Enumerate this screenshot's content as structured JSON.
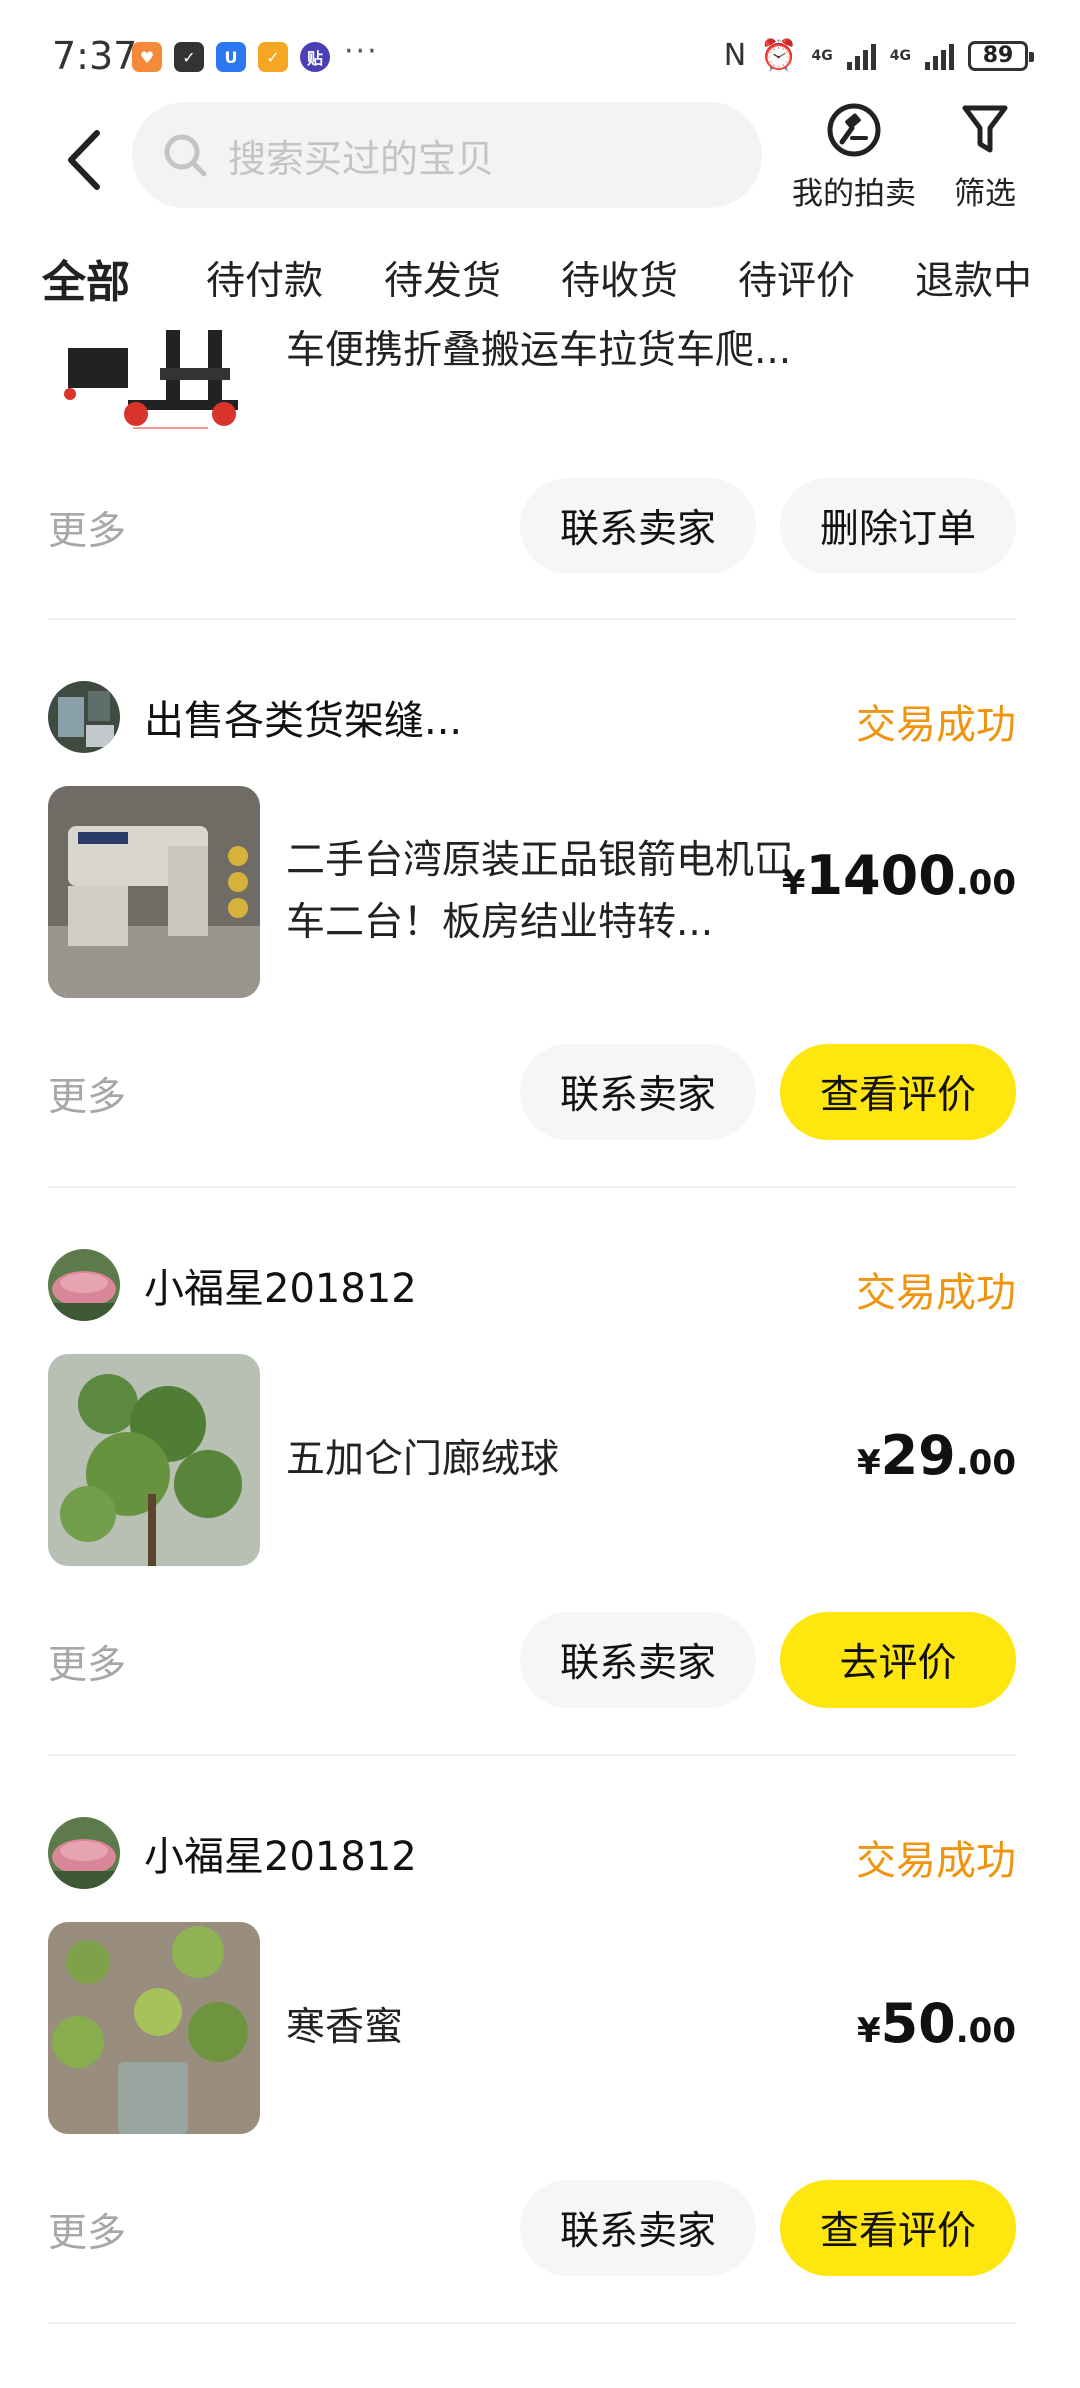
{
  "status_bar": {
    "time": "7:37",
    "dots": "···",
    "net1": "4G",
    "net2": "4G",
    "battery": "89",
    "nfc_icon": "N",
    "alarm_icon": "⏰"
  },
  "header": {
    "search_placeholder": "搜索买过的宝贝",
    "auction_label": "我的拍卖",
    "filter_label": "筛选"
  },
  "tabs": [
    {
      "label": "全部",
      "active": true
    },
    {
      "label": "待付款"
    },
    {
      "label": "待发货"
    },
    {
      "label": "待收货"
    },
    {
      "label": "待评价"
    },
    {
      "label": "退款中"
    }
  ],
  "orders": [
    {
      "product_title_partial": "车便携折叠搬运车拉货车爬...",
      "more_label": "更多",
      "contact_label": "联系卖家",
      "action_label": "删除订单"
    },
    {
      "seller_name": "出售各类货架缝...",
      "status": "交易成功",
      "product_title": "二手台湾原装正品银箭电机冚车二台！板房结业特转...",
      "price_currency": "¥",
      "price_int": "1400",
      "price_dec": ".00",
      "more_label": "更多",
      "contact_label": "联系卖家",
      "action_label": "查看评价"
    },
    {
      "seller_name": "小福星201812",
      "status": "交易成功",
      "product_title": "五加仑门廊绒球",
      "price_currency": "¥",
      "price_int": "29",
      "price_dec": ".00",
      "more_label": "更多",
      "contact_label": "联系卖家",
      "action_label": "去评价"
    },
    {
      "seller_name": "小福星201812",
      "status": "交易成功",
      "product_title": "寒香蜜",
      "price_currency": "¥",
      "price_int": "50",
      "price_dec": ".00",
      "more_label": "更多",
      "contact_label": "联系卖家",
      "action_label": "查看评价"
    }
  ],
  "colors": {
    "accent_yellow": "#ffe60f",
    "status_orange": "#f09310",
    "muted_text": "#a7a7a7"
  }
}
